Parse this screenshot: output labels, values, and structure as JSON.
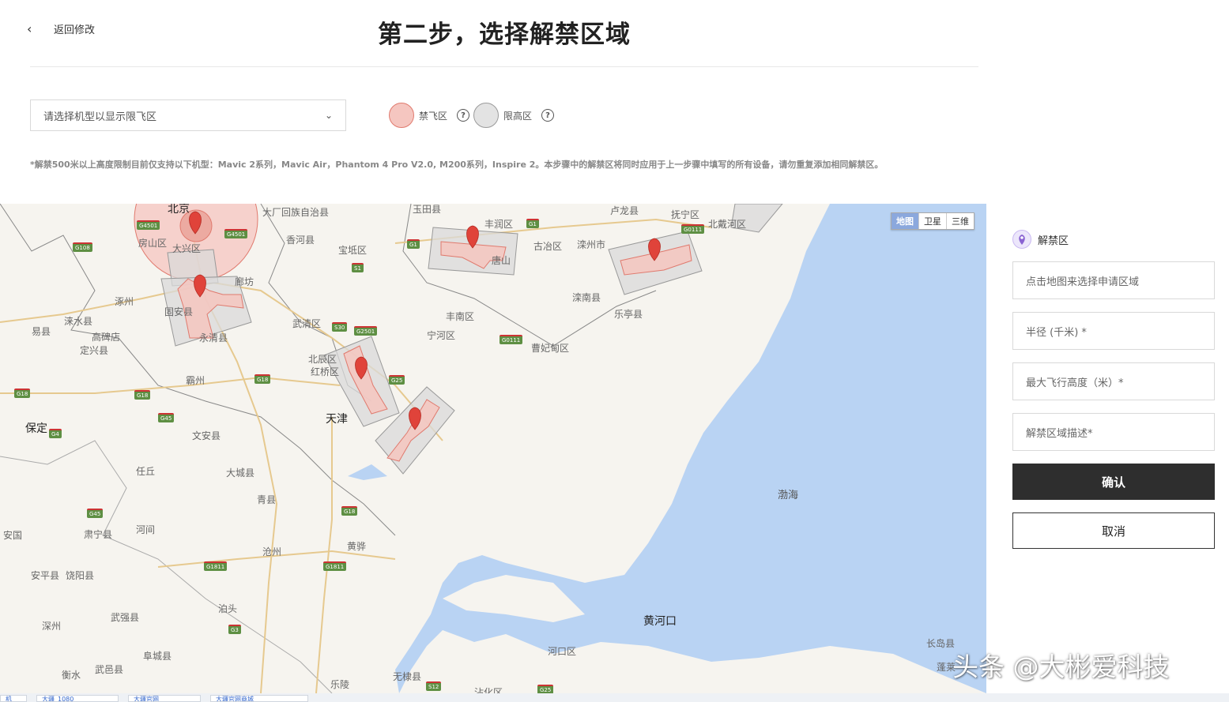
{
  "header": {
    "back_label": "返回修改",
    "title": "第二步，选择解禁区域",
    "select_placeholder": "请选择机型以显示限飞区",
    "legend_nofly": "禁飞区",
    "legend_limit": "限高区",
    "note": "*解禁500米以上高度限制目前仅支持以下机型：Mavic 2系列，Mavic Air，Phantom 4 Pro V2.0, M200系列，Inspire 2。本步骤中的解禁区将同时应用于上一步骤中填写的所有设备，请勿重复添加相同解禁区。"
  },
  "map": {
    "type_buttons": [
      "地图",
      "卫星",
      "三维"
    ],
    "active_type": "地图",
    "cities": [
      "北京",
      "天津",
      "保定",
      "黄河口"
    ],
    "towns": [
      "大厂回族自治县",
      "玉田县",
      "丰润区",
      "卢龙县",
      "抚宁区",
      "北戴河区",
      "房山区",
      "大兴区",
      "香河县",
      "宝坻区",
      "古冶区",
      "滦州市",
      "涿州",
      "廊坊",
      "固安县",
      "滦南县",
      "乐亭县",
      "涞水县",
      "易县",
      "高碑店",
      "定兴县",
      "永清县",
      "武清区",
      "丰南区",
      "宁河区",
      "曹妃甸区",
      "北辰区",
      "红桥区",
      "霸州",
      "文安县",
      "任丘",
      "大城县",
      "青县",
      "河间",
      "肃宁县",
      "安国",
      "安平县",
      "饶阳县",
      "沧州",
      "黄骅",
      "泊头",
      "武强县",
      "深州",
      "阜城县",
      "衡水",
      "武邑县",
      "河口区",
      "无棣县",
      "乐陵",
      "长岛县",
      "蓬莱",
      "唐山",
      "乐亭",
      "沾化区"
    ],
    "sea": "渤海",
    "highways": [
      "G4501",
      "G4501",
      "G108",
      "G1",
      "G1",
      "G0111",
      "S1",
      "S30",
      "G2501",
      "G0111",
      "G18",
      "G18",
      "G18",
      "G25",
      "G45",
      "G4",
      "G45",
      "G18",
      "G1811",
      "G1811",
      "G3",
      "S12",
      "G25"
    ]
  },
  "panel": {
    "section_title": "解禁区",
    "field_area_placeholder": "点击地图来选择申请区域",
    "field_radius_placeholder": "半径 (千米) *",
    "field_height_placeholder": "最大飞行高度（米）*",
    "field_desc_placeholder": "解禁区域描述*",
    "confirm_label": "确认",
    "cancel_label": "取消"
  },
  "bottom_tabs": [
    "机",
    "大疆_1080",
    "大疆官网",
    "大疆官网商城"
  ],
  "colors": {
    "nofly_fill": "#f5c6c0",
    "nofly_stroke": "#e07a6e",
    "limit_fill": "#e3e3e3",
    "marker": "#e0433a",
    "sea": "#b9d3f3",
    "confirm_bg": "#2e2e2e",
    "highway": "#5e8f43"
  },
  "watermark": "头条 @大彬爱科技"
}
